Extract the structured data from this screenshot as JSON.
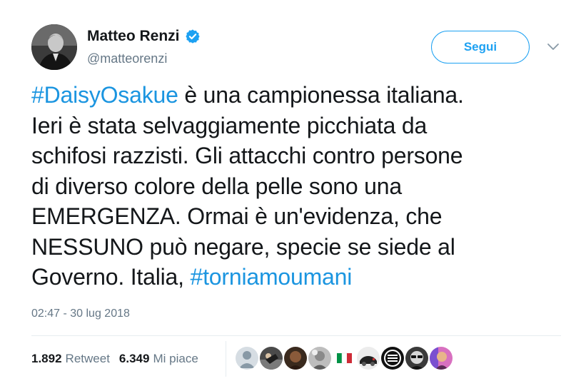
{
  "author": {
    "name": "Matteo Renzi",
    "handle": "@matteorenzi",
    "verified": true
  },
  "follow_button": {
    "label": "Segui"
  },
  "tweet": {
    "lines": [
      [
        {
          "text": "#DaisyOsakue",
          "hashtag": true
        },
        {
          "text": " è una campionessa italiana.",
          "hashtag": false
        }
      ],
      [
        {
          "text": "Ieri è stata selvaggiamente picchiata da",
          "hashtag": false
        }
      ],
      [
        {
          "text": "schifosi razzisti. Gli attacchi contro persone",
          "hashtag": false
        }
      ],
      [
        {
          "text": "di diverso colore della pelle sono una",
          "hashtag": false
        }
      ],
      [
        {
          "text": "EMERGENZA. Ormai è un'evidenza, che",
          "hashtag": false
        }
      ],
      [
        {
          "text": "NESSUNO può negare, specie se siede al",
          "hashtag": false
        }
      ],
      [
        {
          "text": "Governo. Italia, ",
          "hashtag": false
        },
        {
          "text": "#torniamoumani",
          "hashtag": true
        }
      ]
    ],
    "timestamp": "02:47 - 30 lug 2018"
  },
  "stats": {
    "retweets": {
      "count": "1.892",
      "label": "Retweet"
    },
    "likes": {
      "count": "6.349",
      "label": "Mi piace"
    }
  },
  "likers": [
    {
      "icon": "default-avatar-icon",
      "color": "#c4ccd4"
    },
    {
      "icon": "sports-photo-avatar",
      "color": "#3a3a3a"
    },
    {
      "icon": "portrait-avatar",
      "color": "#5a3a22"
    },
    {
      "icon": "grayscale-portrait-avatar",
      "color": "#9a9a9a"
    },
    {
      "icon": "italian-flag-avatar",
      "color": "#ffffff"
    },
    {
      "icon": "car-avatar",
      "color": "#e8e8e8"
    },
    {
      "icon": "real-meat-society-logo-avatar",
      "color": "#111111"
    },
    {
      "icon": "sunglasses-avatar",
      "color": "#2b2b2b"
    },
    {
      "icon": "colorful-portrait-avatar",
      "color": "#b04b9c"
    }
  ],
  "colors": {
    "accent": "#1da1f2",
    "hashtag": "#1b95e0",
    "text": "#14171a",
    "secondary": "#657786",
    "divider": "#e6ecf0"
  }
}
